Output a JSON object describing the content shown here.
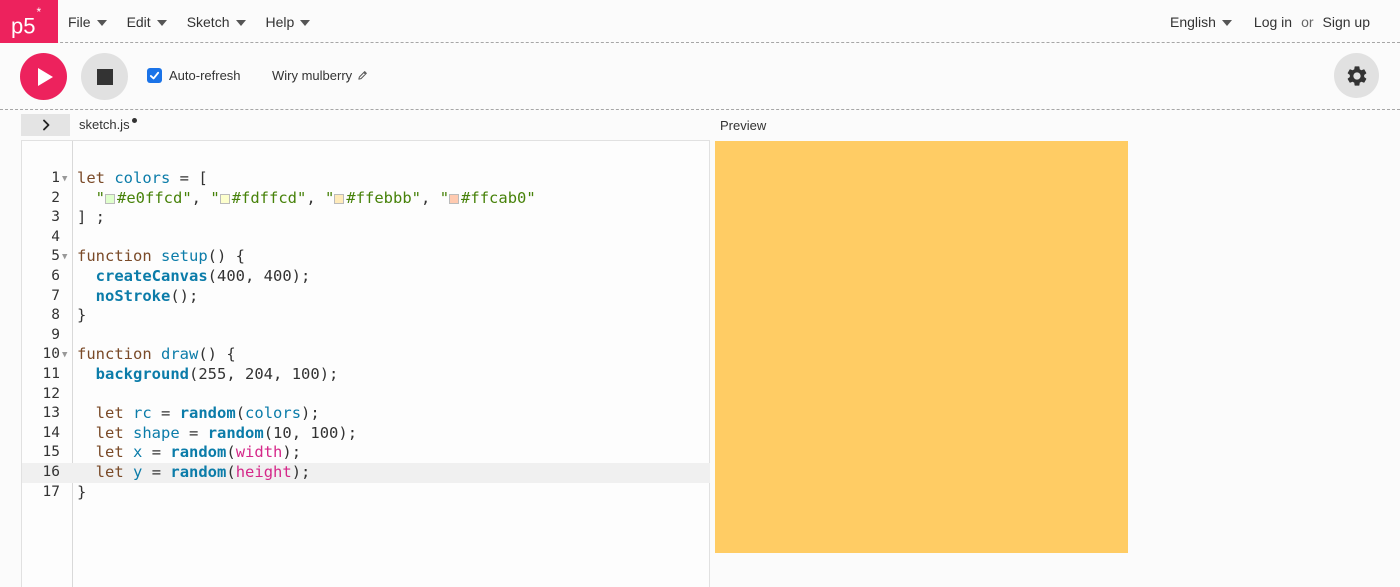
{
  "logo": {
    "text": "p5",
    "mark": "*"
  },
  "nav": {
    "menus": [
      {
        "label": "File"
      },
      {
        "label": "Edit"
      },
      {
        "label": "Sketch"
      },
      {
        "label": "Help"
      }
    ],
    "language": "English",
    "login": "Log in",
    "or": "or",
    "signup": "Sign up"
  },
  "toolbar": {
    "auto_refresh_label": "Auto-refresh",
    "auto_refresh_checked": true,
    "sketch_name": "Wiry mulberry"
  },
  "editor": {
    "file_name": "sketch.js",
    "active_line": 16,
    "line_numbers": [
      "1",
      "2",
      "3",
      "4",
      "5",
      "6",
      "7",
      "8",
      "9",
      "10",
      "11",
      "12",
      "13",
      "14",
      "15",
      "16",
      "17"
    ],
    "swatch_colors": [
      "#e0ffcd",
      "#fdffcd",
      "#ffebbb",
      "#ffcab0"
    ]
  },
  "preview": {
    "label": "Preview",
    "background": "#ffcc64"
  },
  "colors": {
    "brand": "#ed225d",
    "checkbox": "#1a73e8"
  }
}
